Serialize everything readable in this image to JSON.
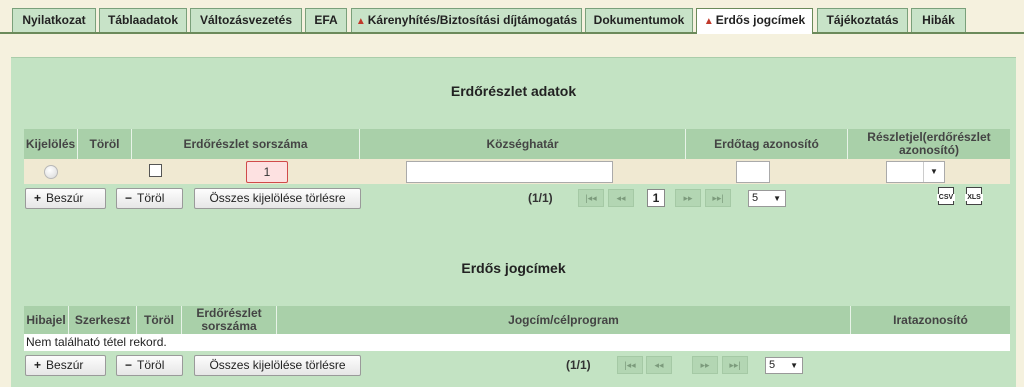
{
  "tabs": [
    {
      "label": "Nyilatkozat",
      "warning": false,
      "active": false
    },
    {
      "label": "Táblaadatok",
      "warning": false,
      "active": false
    },
    {
      "label": "Változásvezetés",
      "warning": false,
      "active": false
    },
    {
      "label": "EFA",
      "warning": false,
      "active": false
    },
    {
      "label": "Kárenyhítés/Biztosítási díjtámogatás",
      "warning": true,
      "active": false
    },
    {
      "label": "Dokumentumok",
      "warning": false,
      "active": false
    },
    {
      "label": "Erdős jogcímek",
      "warning": true,
      "active": true
    },
    {
      "label": "Tájékoztatás",
      "warning": false,
      "active": false
    },
    {
      "label": "Hibák",
      "warning": false,
      "active": false
    }
  ],
  "section1": {
    "title": "Erdőrészlet adatok",
    "columns": {
      "select": "Kijelölés",
      "delete": "Töröl",
      "number": "Erdőrészlet sorszáma",
      "district": "Községhatár",
      "forest_id": "Erdőtag azonosító",
      "subplot": "Részletjel(erdőrészlet azonosító)"
    },
    "row": {
      "number": "1",
      "district": "",
      "forest_id": "",
      "subplot": ""
    },
    "buttons": {
      "insert": "Beszúr",
      "delete": "Töröl",
      "clear": "Összes kijelölése törlésre"
    },
    "pager": {
      "info": "(1/1)",
      "current": "1",
      "page_size": "5"
    },
    "exports": {
      "csv": "CSV",
      "xls": "XLS"
    }
  },
  "section2": {
    "title": "Erdős jogcímek",
    "columns": {
      "error": "Hibajel",
      "edit": "Szerkeszt",
      "delete": "Töröl",
      "number": "Erdőrészlet sorszáma",
      "program": "Jogcím/célprogram",
      "docid": "Iratazonosító"
    },
    "empty_text": "Nem található tétel rekord.",
    "buttons": {
      "insert": "Beszúr",
      "delete": "Töröl",
      "clear": "Összes kijelölése törlésre"
    },
    "pager": {
      "info": "(1/1)",
      "page_size": "5"
    }
  },
  "icons": {
    "warning": "▲",
    "plus": "+",
    "minus": "−",
    "first": "|◂◂",
    "prev": "◂◂",
    "next": "▸▸",
    "last": "▸▸|",
    "caret": "▼"
  },
  "colors": {
    "panel": "#c3e3c3",
    "header": "#a9d0a9",
    "tab": "#c8e3c8",
    "warning": "#c0392b",
    "page_bg": "#f5f1de"
  }
}
